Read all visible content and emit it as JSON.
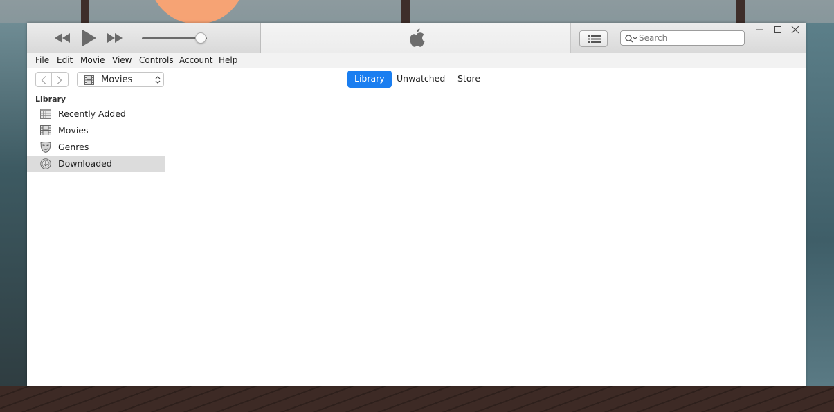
{
  "player": {
    "rewind_icon": "rewind-icon",
    "play_icon": "play-icon",
    "fast_forward_icon": "fast-forward-icon",
    "volume_level": 0.9
  },
  "lcd": {
    "logo_icon": "apple-logo-icon"
  },
  "toolbar": {
    "list_view_icon": "list-icon",
    "search": {
      "placeholder": "Search",
      "value": ""
    }
  },
  "window_controls": [
    "minimize",
    "maximize",
    "close"
  ],
  "menu": {
    "items": [
      "File",
      "Edit",
      "Movie",
      "View",
      "Controls",
      "Account",
      "Help"
    ]
  },
  "nav": {
    "back_icon": "chevron-left-icon",
    "forward_icon": "chevron-right-icon",
    "media_select": {
      "selected": "Movies",
      "icon": "film-icon"
    },
    "tabs": [
      {
        "label": "Library",
        "active": true
      },
      {
        "label": "Unwatched",
        "active": false
      },
      {
        "label": "Store",
        "active": false
      }
    ],
    "accent_color": "#1a7ef0"
  },
  "sidebar": {
    "heading": "Library",
    "items": [
      {
        "label": "Recently Added",
        "icon": "calendar-grid-icon",
        "selected": false
      },
      {
        "label": "Movies",
        "icon": "film-icon",
        "selected": false
      },
      {
        "label": "Genres",
        "icon": "theater-masks-icon",
        "selected": false
      },
      {
        "label": "Downloaded",
        "icon": "download-circle-icon",
        "selected": true
      }
    ]
  }
}
